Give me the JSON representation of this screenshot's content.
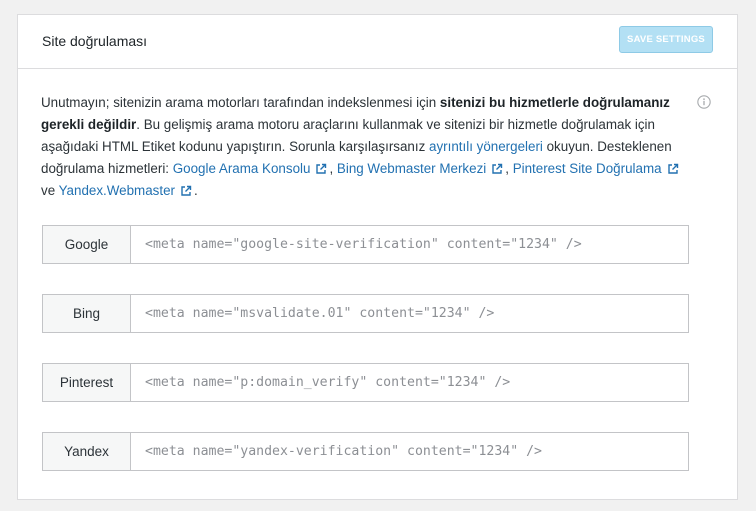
{
  "panel": {
    "title": "Site doğrulaması",
    "save_label": "SAVE SETTINGS"
  },
  "description": {
    "p1": "Unutmayın; sitenizin arama motorları tarafından indekslenmesi için ",
    "bold1": "sitenizi bu hizmetlerle doğrulamanız gerekli değildir",
    "p2": ". Bu gelişmiş arama motoru araçlarını kullanmak ve sitenizi bir hizmetle doğrulamak için aşağıdaki HTML Etiket kodunu yapıştırın. Sorunla karşılaşırsanız ",
    "link_guidelines": "ayrıntılı yönergeleri",
    "p3": " okuyun. Desteklenen doğrulama hizmetleri: ",
    "link_google": "Google Arama Konsolu",
    "sep1": ", ",
    "link_bing": "Bing Webmaster Merkezi",
    "sep2": ", ",
    "link_pinterest": "Pinterest Site Doğrulama",
    "sep3": " ve ",
    "link_yandex": "Yandex.Webmaster",
    "end": "."
  },
  "services": [
    {
      "label": "Google",
      "code": "<meta name=\"google-site-verification\" content=\"1234\" />"
    },
    {
      "label": "Bing",
      "code": "<meta name=\"msvalidate.01\" content=\"1234\" />"
    },
    {
      "label": "Pinterest",
      "code": "<meta name=\"p:domain_verify\" content=\"1234\" />"
    },
    {
      "label": "Yandex",
      "code": "<meta name=\"yandex-verification\" content=\"1234\" />"
    }
  ],
  "icons": {
    "info": "info-circle-icon",
    "external": "external-link-icon"
  },
  "colors": {
    "link": "#2271b1",
    "button_bg": "#b3e0f4"
  }
}
